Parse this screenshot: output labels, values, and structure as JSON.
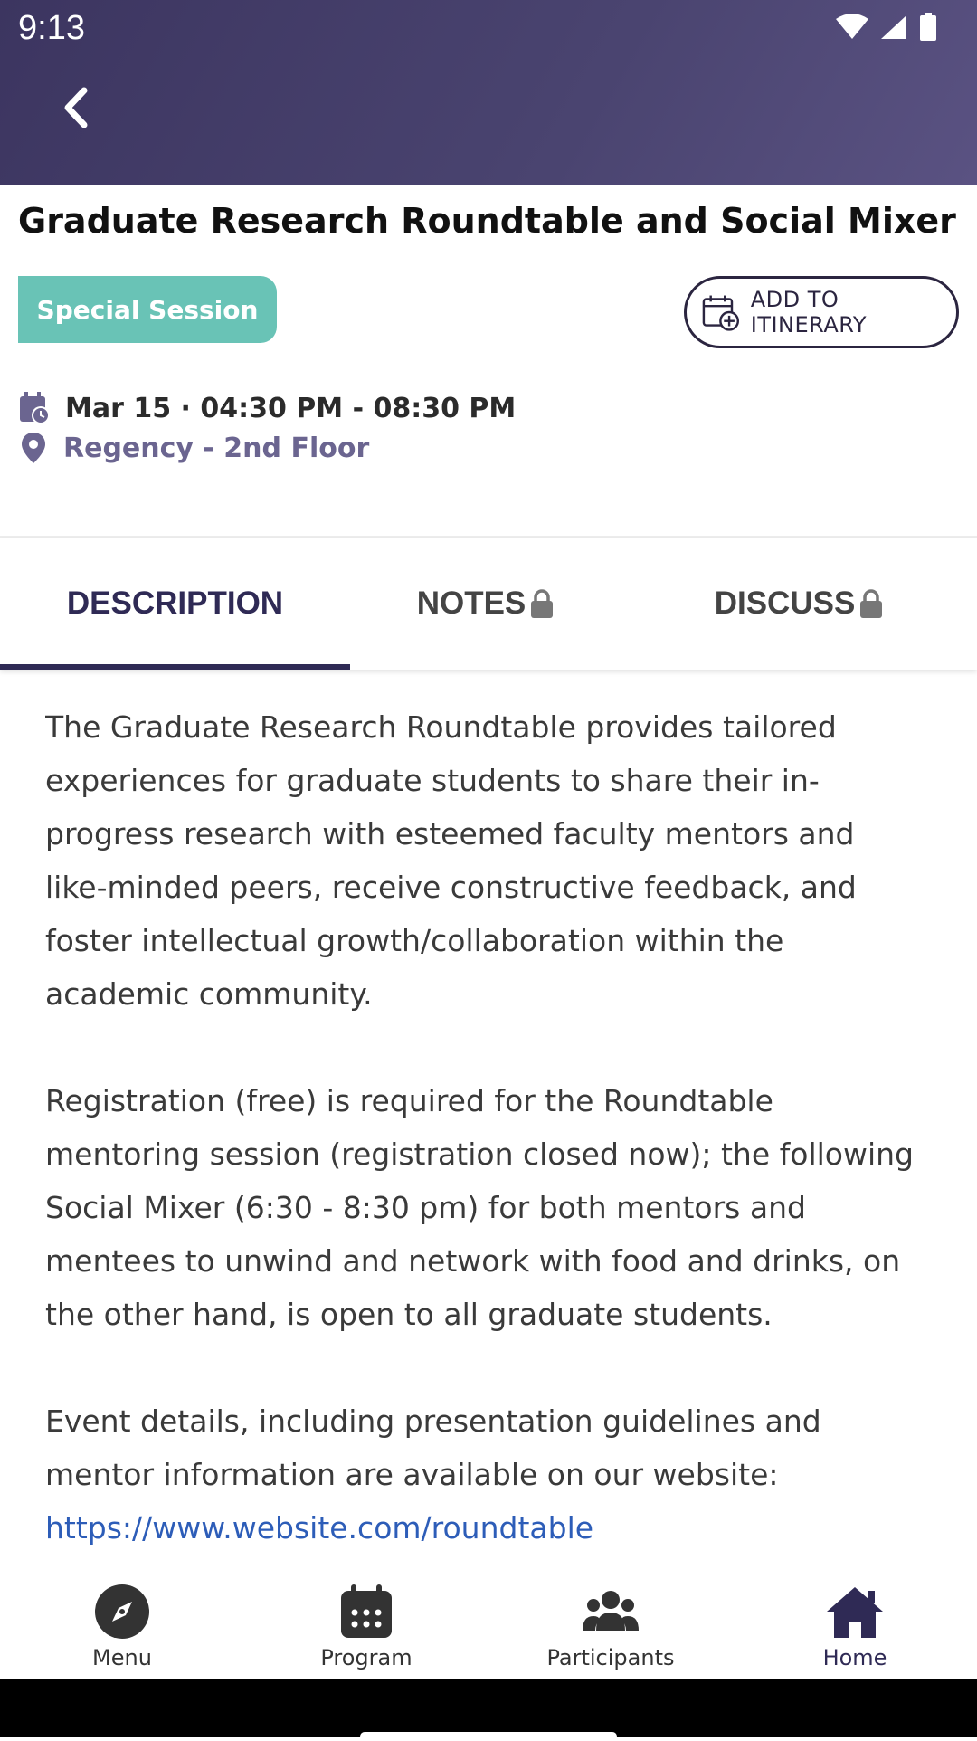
{
  "status_bar": {
    "time": "9:13"
  },
  "event": {
    "title": "Graduate Research Roundtable and Social Mixer",
    "badge": "Special Session",
    "add_itinerary_label": "ADD TO ITINERARY",
    "datetime": "Mar 15 · 04:30 PM - 08:30 PM",
    "location": "Regency - 2nd Floor"
  },
  "tabs": [
    {
      "label": "DESCRIPTION",
      "active": true
    },
    {
      "label": "NOTES",
      "locked": true
    },
    {
      "label": "DISCUSS",
      "locked": true
    }
  ],
  "description": {
    "p1": "The Graduate Research Roundtable provides tailored experiences for graduate students to share their in-progress research with esteemed faculty mentors and like-minded peers, receive constructive feedback, and foster intellectual growth/collaboration within the academic community.",
    "p2": "Registration (free) is required for the Roundtable mentoring session (registration closed now); the following Social Mixer (6:30 - 8:30 pm) for both mentors and mentees to unwind and network with food and drinks, on the other hand, is open to all graduate students.",
    "p3": "Event details, including presentation guidelines and mentor information are available on our website:",
    "link": "https://www.website.com/roundtable"
  },
  "bottom_nav": [
    {
      "label": "Menu",
      "icon": "compass-icon"
    },
    {
      "label": "Program",
      "icon": "calendar-icon"
    },
    {
      "label": "Participants",
      "icon": "people-icon"
    },
    {
      "label": "Home",
      "icon": "home-icon"
    }
  ],
  "colors": {
    "header": "#3c3560",
    "accent": "#2f2a55",
    "badge": "#69c3b6",
    "location": "#6b6590"
  }
}
